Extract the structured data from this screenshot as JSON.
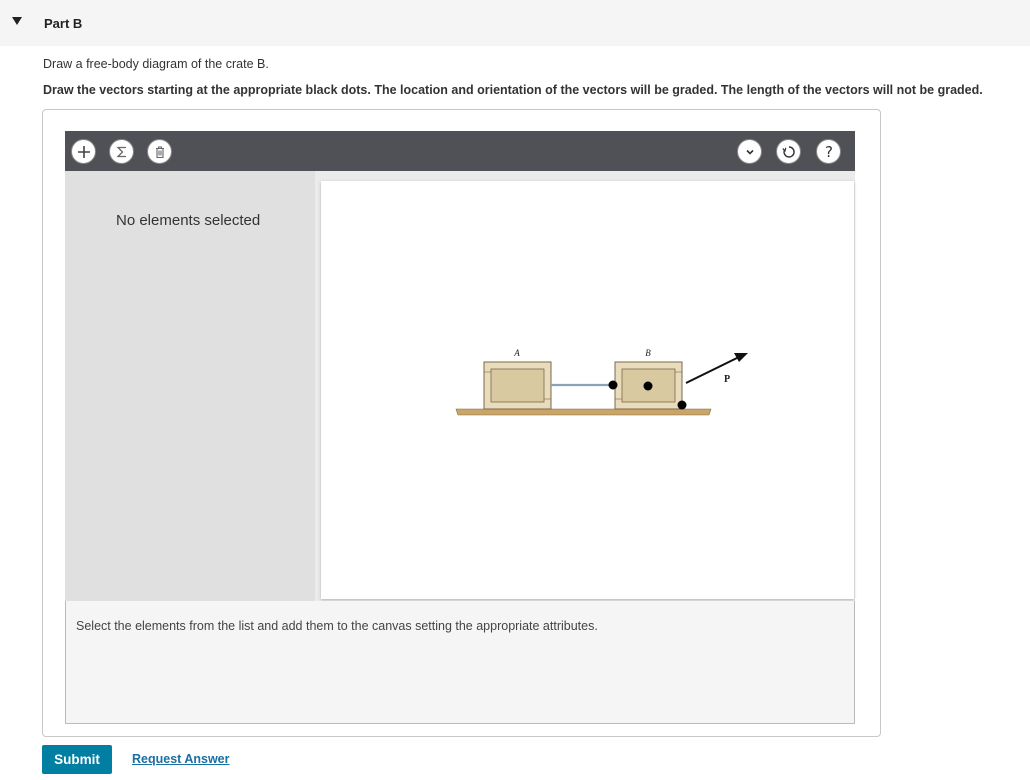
{
  "part": {
    "title": "Part B"
  },
  "intro_text": "Draw a free-body diagram of the crate B.",
  "instruction_text": "Draw the vectors starting at the appropriate black dots. The location and orientation of the vectors will be graded. The length of the vectors will not be graded.",
  "toolbar": {
    "left_icons": [
      "plus-icon",
      "sigma-icon",
      "trash-icon"
    ],
    "right_icons": [
      "chevron-down-icon",
      "reset-icon",
      "help-icon"
    ]
  },
  "left_panel": {
    "no_selection_text": "No elements selected"
  },
  "figure": {
    "crate_a_label": "A",
    "crate_b_label": "B",
    "force_label": "P"
  },
  "hint_text": "Select the elements from the list and add them to the canvas setting the appropriate attributes.",
  "actions": {
    "submit_label": "Submit",
    "request_answer_label": "Request Answer"
  },
  "colors": {
    "toolbar": "#4f5156",
    "submit": "#007fa3",
    "link": "#1a6fa3",
    "crate": "#e8dcbc",
    "ground": "#c9a56a"
  }
}
